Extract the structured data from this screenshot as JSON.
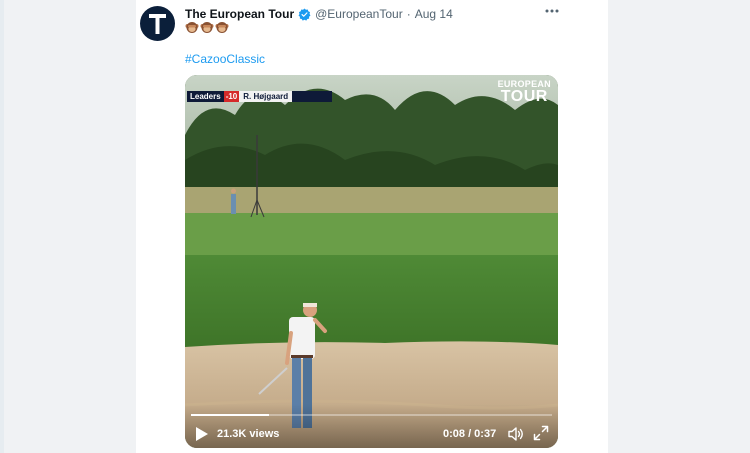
{
  "tweet": {
    "author_name": "The European Tour",
    "handle": "@EuropeanTour",
    "separator": "·",
    "date": "Aug 14",
    "avatar_letter": "T",
    "emojis": [
      "monkey-icon",
      "monkey-icon",
      "monkey-icon"
    ],
    "hashtag": "#CazooClassic",
    "colors": {
      "link": "#1d9bf0",
      "verified": "#1d9bf0",
      "avatar_bg": "#0b1f3a"
    }
  },
  "video": {
    "scoreboard": {
      "label": "Leaders",
      "score": "-10",
      "player": "R. Højgaard"
    },
    "brand_logo": {
      "top": "EUROPEAN",
      "bottom": "TOUR"
    },
    "views": "21.3K views",
    "time": "0:08 / 0:37",
    "progress": 0.216
  }
}
